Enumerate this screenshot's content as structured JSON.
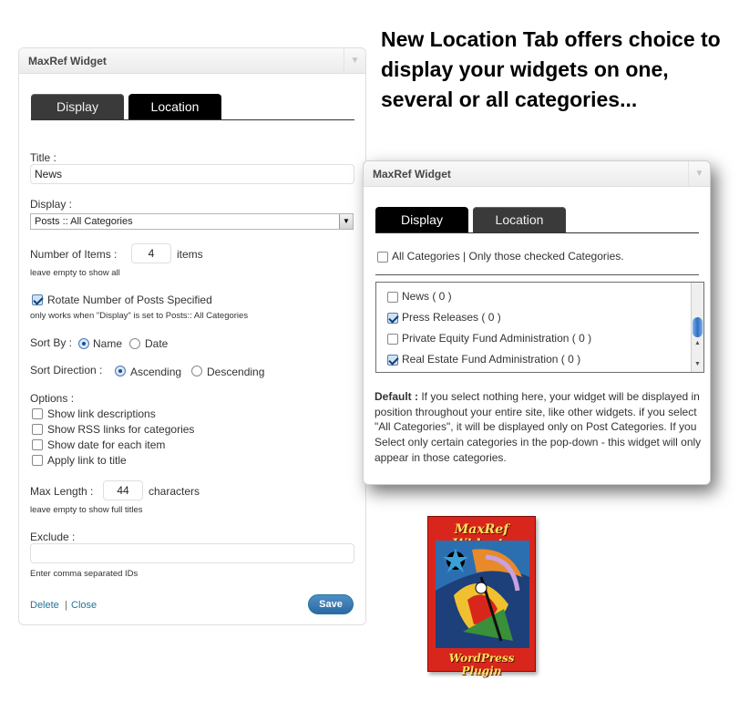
{
  "headline": "New Location Tab offers choice to display your widgets on one, several or all categories...",
  "left_widget": {
    "title": "MaxRef Widget",
    "tabs": [
      "Display",
      "Location"
    ],
    "title_label": "Title :",
    "title_value": "News",
    "display_label": "Display :",
    "display_value": "Posts :: All Categories",
    "num_items_label": "Number of Items :",
    "num_items_value": "4",
    "num_items_suffix": "items",
    "num_items_hint": "leave empty to show all",
    "rotate_label": "Rotate Number of Posts Specified",
    "rotate_checked": true,
    "rotate_hint": "only works when \"Display\" is set to Posts:: All Categories",
    "sort_by_label": "Sort By :",
    "sort_by_options": [
      "Name",
      "Date"
    ],
    "sort_by_selected": "Name",
    "sort_dir_label": "Sort Direction :",
    "sort_dir_options": [
      "Ascending",
      "Descending"
    ],
    "sort_dir_selected": "Ascending",
    "options_label": "Options :",
    "options": [
      {
        "label": "Show link descriptions",
        "checked": false
      },
      {
        "label": "Show RSS links for categories",
        "checked": false
      },
      {
        "label": "Show date for each item",
        "checked": false
      },
      {
        "label": "Apply link to title",
        "checked": false
      }
    ],
    "max_length_label": "Max Length :",
    "max_length_value": "44",
    "max_length_suffix": "characters",
    "max_length_hint": "leave empty to show full titles",
    "exclude_label": "Exclude :",
    "exclude_value": "",
    "exclude_hint": "Enter comma separated IDs",
    "delete_link": "Delete",
    "separator": "|",
    "close_link": "Close",
    "save_label": "Save"
  },
  "right_widget": {
    "title": "MaxRef Widget",
    "tabs": [
      "Display",
      "Location"
    ],
    "all_categories_label": "All Categories | Only those checked Categories.",
    "all_categories_checked": false,
    "categories": [
      {
        "label": "News ( 0 )",
        "checked": false
      },
      {
        "label": "Press Releases ( 0 )",
        "checked": true
      },
      {
        "label": "Private Equity Fund Administration ( 0 )",
        "checked": false
      },
      {
        "label": "Real Estate Fund Administration ( 0 )",
        "checked": true
      }
    ],
    "default_bold": "Default :",
    "default_text": " If you select nothing here, your widget will be displayed in position throughout your entire site, like other widgets. if you select \"All Categories\", it will be displayed only on Post Categories. If you Select only certain categories in the pop-down - this widget will only appear in those categories."
  },
  "logo": {
    "top_text": "MaxRef Widgets",
    "bottom_text": "WordPress Plugin"
  },
  "colors": {
    "link": "#21759b",
    "save_button": "#2a6aa3",
    "logo_red": "#d9261c",
    "logo_yellow": "#ffe15a"
  }
}
